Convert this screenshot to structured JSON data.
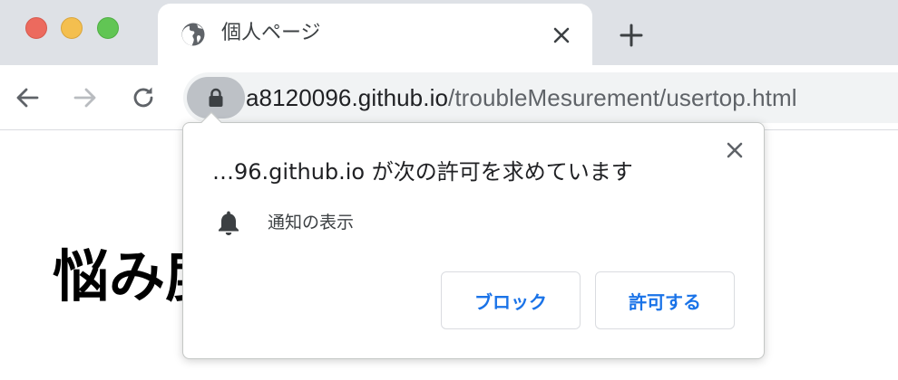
{
  "tab": {
    "title": "個人ページ",
    "icon": "globe-icon"
  },
  "toolbar": {
    "url_host": "a8120096.github.io",
    "url_path": "/troubleMesurement/usertop.html"
  },
  "page": {
    "heading": "悩み度"
  },
  "permission": {
    "title": "…96.github.io が次の許可を求めています",
    "item_label": "通知の表示",
    "item_icon": "bell-icon",
    "block_label": "ブロック",
    "allow_label": "許可する"
  },
  "colors": {
    "accent": "#1a73e8",
    "tabstrip": "#dee1e6",
    "omnibox": "#f1f3f4"
  }
}
